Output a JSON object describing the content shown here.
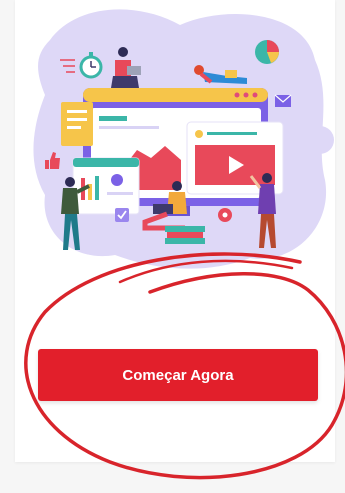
{
  "cta": {
    "label": "Começar Agora"
  },
  "colors": {
    "primary_red": "#e21f2b",
    "annotation_red": "#d8242b",
    "blob_lavender": "#ded8f7",
    "screen_purple": "#7b61e6",
    "screen_yellow": "#f6c54a"
  },
  "icons": [
    "stopwatch-icon",
    "pie-chart-icon",
    "mail-icon",
    "thumbs-up-icon",
    "gear-icon",
    "play-icon",
    "checkbox-icon"
  ]
}
